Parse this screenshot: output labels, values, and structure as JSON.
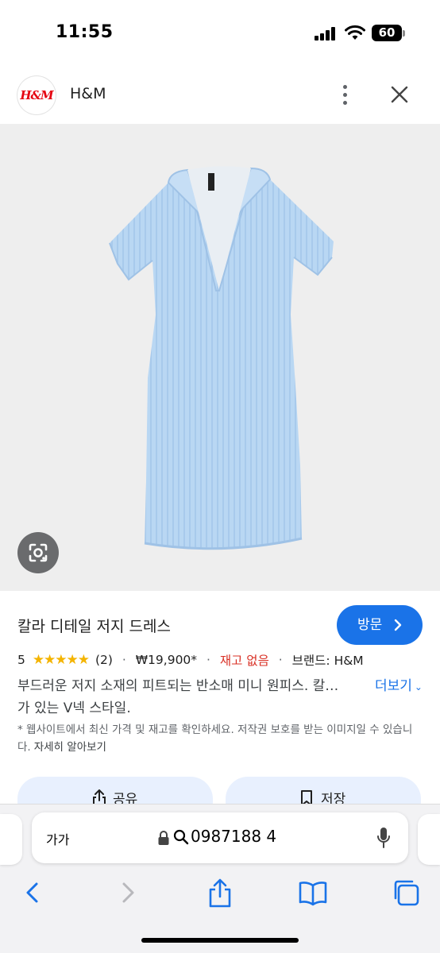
{
  "status_bar": {
    "time": "11:55",
    "battery": "60",
    "icons": [
      "cellular-signal-icon",
      "wifi-icon",
      "battery-icon"
    ]
  },
  "site": {
    "logo_text": "H&M",
    "name": "H&M",
    "icons": [
      "more-vert-icon",
      "close-icon"
    ]
  },
  "product": {
    "title": "칼라 디테일 저지 드레스",
    "visit_label": "방문",
    "rating": "5",
    "stars": "★★★★★",
    "review_count": "(2)",
    "price": "₩19,900*",
    "stock": "재고 없음",
    "brand": "브랜드: H&M",
    "separator": "·",
    "description_line1": "부드러운 저지 소재의 피트되는 반소매 미니 원피스. 칼…",
    "description_line2": "가 있는 V넥 스타일.",
    "more_label": "더보기",
    "note": "* 웹사이트에서 최신 가격 및 재고를 확인하세요. 저작권 보호를 받는 이미지일 수 있습니다.",
    "note_link": "자세히 알아보기",
    "share_label": "공유",
    "save_label": "저장",
    "rating_value": 5,
    "colors": {
      "accent": "#1a73e8",
      "star": "#f4b400",
      "out_of_stock": "#d93025",
      "dress": "#b7d6f2"
    }
  },
  "browser": {
    "text_size_label": "가가",
    "url": "0987188 4",
    "toolbar_icons": [
      "back-icon",
      "forward-icon",
      "share-icon",
      "bookmarks-icon",
      "tabs-icon"
    ]
  }
}
